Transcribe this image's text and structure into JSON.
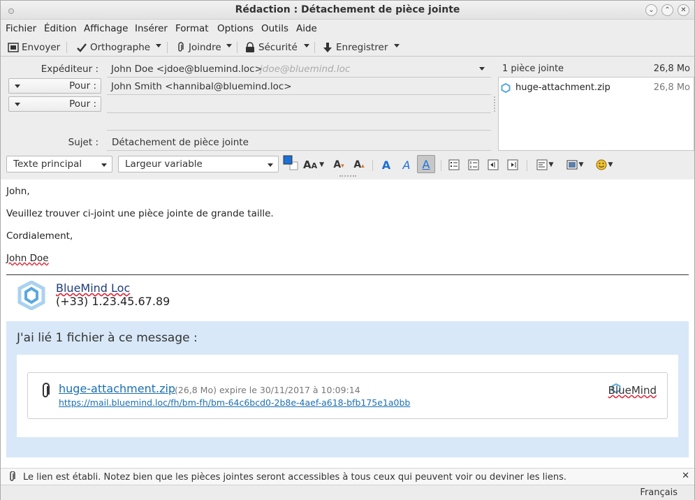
{
  "window": {
    "title": "Rédaction : Détachement de pièce jointe"
  },
  "menu": {
    "items": [
      "Fichier",
      "Édition",
      "Affichage",
      "Insérer",
      "Format",
      "Options",
      "Outils",
      "Aide"
    ]
  },
  "toolbar": {
    "send_label": "Envoyer",
    "spell_label": "Orthographe",
    "attach_label": "Joindre",
    "security_label": "Sécurité",
    "save_label": "Enregistrer"
  },
  "header": {
    "from_label": "Expéditeur :",
    "from_value": "John Doe <jdoe@bluemind.loc>",
    "from_identity": "jdoe@bluemind.loc",
    "to_type_1": "Pour :",
    "to_value_1": "John Smith <hannibal@bluemind.loc>",
    "to_type_2": "Pour :",
    "to_value_2": "",
    "subject_label": "Sujet :",
    "subject_value": "Détachement de pièce jointe"
  },
  "attachments": {
    "summary": "1 pièce jointe",
    "total_size": "26,8 Mo",
    "items": [
      {
        "name": "huge-attachment.zip",
        "size": "26,8 Mo"
      }
    ]
  },
  "format_bar": {
    "paragraph_style": "Texte principal",
    "font": "Largeur variable"
  },
  "message": {
    "lines": [
      "John,",
      "Veuillez trouver ci-joint une pièce jointe de grande taille.",
      "Cordialement,",
      "John Doe"
    ],
    "signature_name": "BlueMind Loc",
    "signature_phone": "(+33) 1.23.45.67.89",
    "link_section_title": "J'ai lié 1 fichier à ce message :",
    "linked_file_name": "huge-attachment.zip",
    "linked_file_meta": "(26,8 Mo) expire le 30/11/2017 à 10:09:14",
    "linked_file_url": "https://mail.bluemind.loc/fh/bm-fh/bm-64c6bcd0-2b8e-4aef-a618-bfb175e1a0bb",
    "brand": "BlueMind"
  },
  "notification": {
    "text": "Le lien est établi. Notez bien que les pièces jointes seront accessibles à tous ceux qui peuvent voir ou deviner les liens."
  },
  "status": {
    "language": "Français"
  },
  "colors": {
    "link": "#1a6fb3",
    "brand_blue": "#1e3c7a",
    "link_box_bg": "#d8e8f8",
    "logo_blue": "#5aa8dc"
  }
}
